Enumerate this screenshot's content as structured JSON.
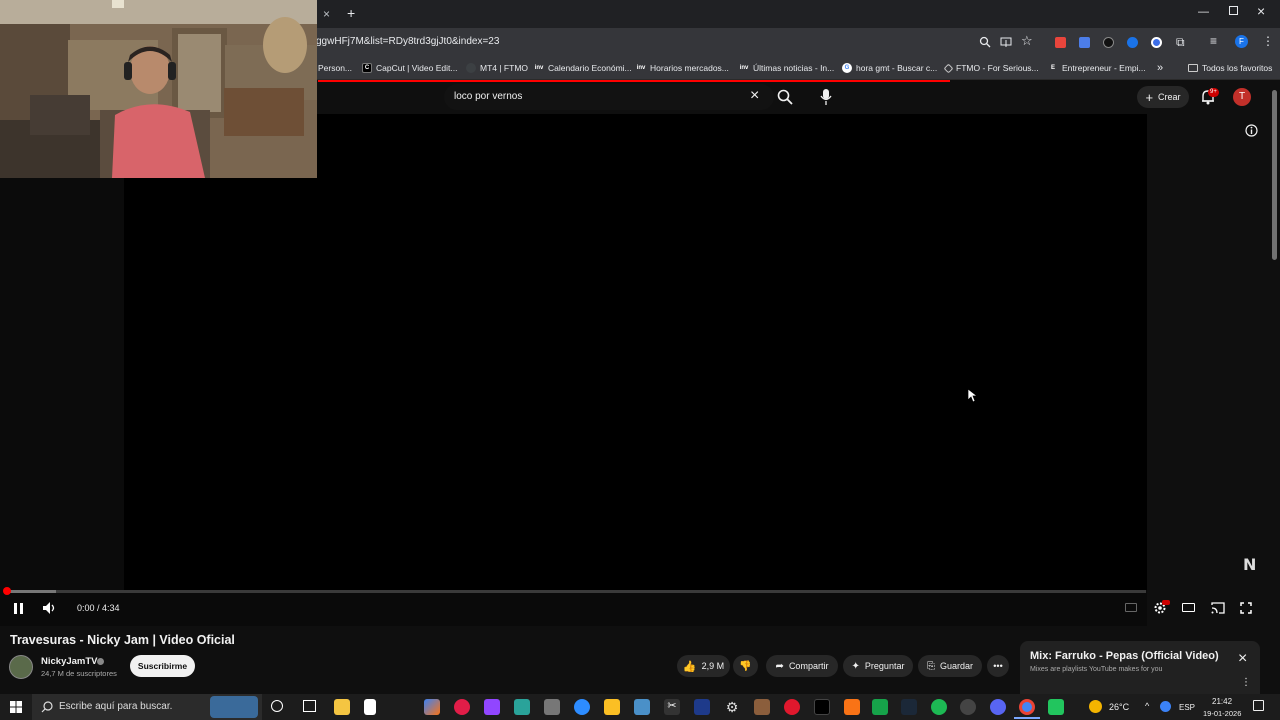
{
  "browser": {
    "new_tab_symbol": "+",
    "close_tab_symbol": "×",
    "url": "ggwHFj7M&list=RDy8trd3gjJt0&index=23",
    "bookmarks": [
      {
        "label": "Person...",
        "icon_color": "#5f6368",
        "icon_text": ""
      },
      {
        "label": "CapCut | Video Edit...",
        "icon_color": "#000000",
        "icon_text": "C"
      },
      {
        "label": "MT4 | FTMO",
        "icon_color": "#3c4043",
        "icon_text": ""
      },
      {
        "label": "Calendario Económi...",
        "icon_color": "#3c4043",
        "icon_text": "inv"
      },
      {
        "label": "Horarios mercados...",
        "icon_color": "#3c4043",
        "icon_text": "inv"
      },
      {
        "label": "Últimas noticias - In...",
        "icon_color": "#3c4043",
        "icon_text": "inv"
      },
      {
        "label": "hora gmt - Buscar c...",
        "icon_color": "#4285f4",
        "icon_text": "G"
      },
      {
        "label": "FTMO - For Serious...",
        "icon_color": "#3c4043",
        "icon_text": ""
      },
      {
        "label": "Entrepreneur - Empi...",
        "icon_color": "#3c4043",
        "icon_text": "E"
      }
    ],
    "all_bookmarks_label": "Todos los favoritos",
    "overflow_label": "»"
  },
  "youtube": {
    "search_value": "loco por vernos",
    "create_label": "Crear",
    "notification_badge": "9+",
    "avatar_letter": "T"
  },
  "player": {
    "time_text": "0:00 / 4:34",
    "progress_fraction": 0.0,
    "watermark": "N"
  },
  "video": {
    "title": "Travesuras - Nicky Jam | Video Oficial",
    "channel_name": "NickyJamTV",
    "subscribers": "24,7 M de suscriptores",
    "subscribe_label": "Suscribirme",
    "likes": "2,9 M",
    "share_label": "Compartir",
    "ask_label": "Preguntar",
    "save_label": "Guardar"
  },
  "mix": {
    "title": "Mix: Farruko - Pepas (Official Video)",
    "subtitle": "Mixes are playlists YouTube makes for you"
  },
  "taskbar": {
    "search_placeholder": "Escribe aquí para buscar.",
    "temperature": "26°C",
    "language": "ESP",
    "time": "21:42",
    "date": "19-01-2026"
  },
  "colors": {
    "youtube_red": "#ff0000",
    "subscribe_bg": "#f1f1f1",
    "weather_icon": "#f4b400"
  }
}
